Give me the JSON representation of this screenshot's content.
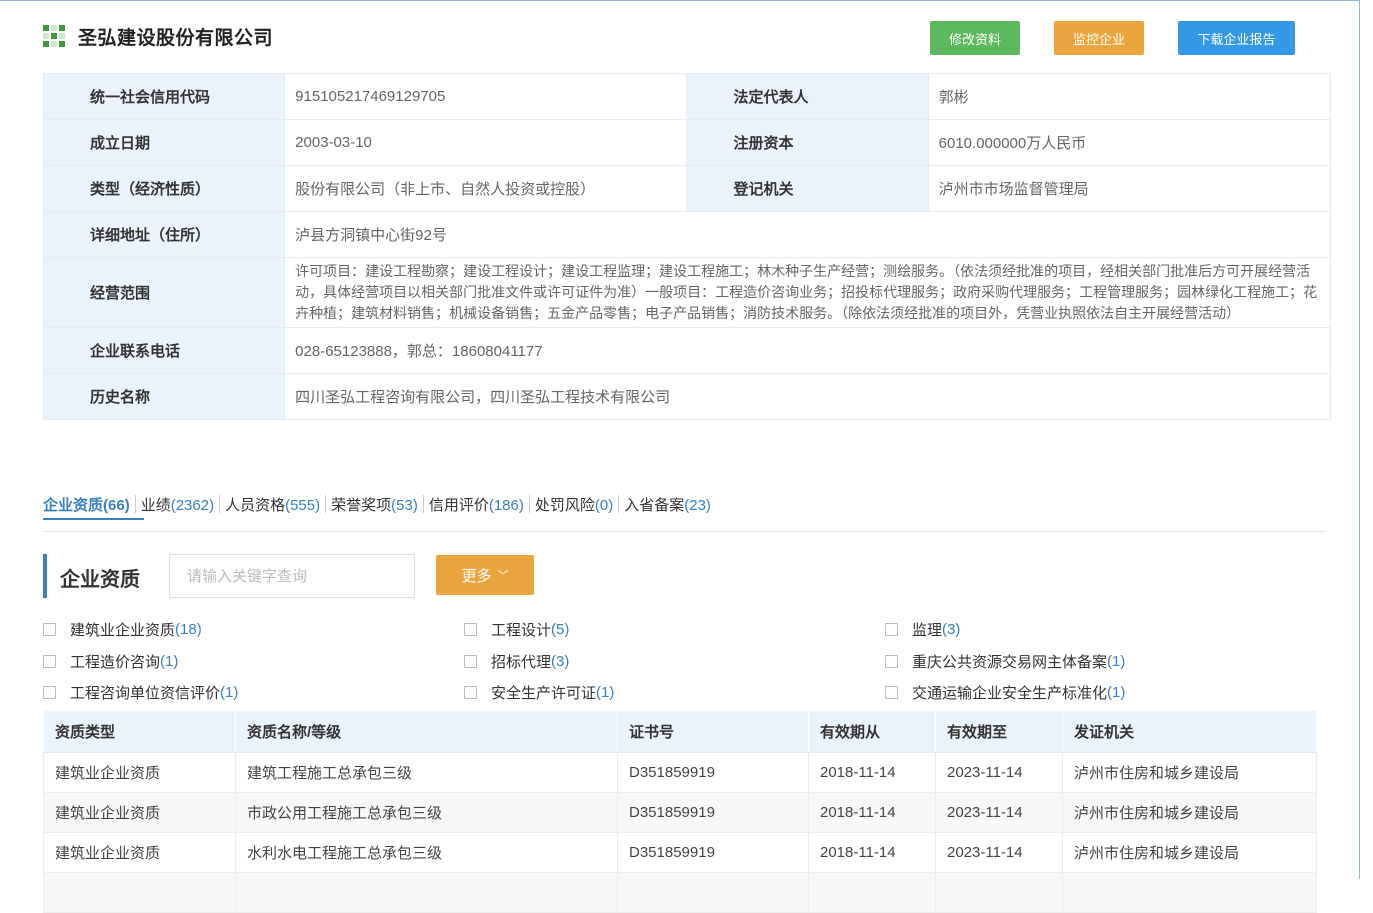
{
  "company": {
    "name": "圣弘建设股份有限公司"
  },
  "actions": {
    "edit": "修改资料",
    "monitor": "监控企业",
    "download": "下载企业报告"
  },
  "info": {
    "credit_code_label": "统一社会信用代码",
    "credit_code": "915105217469129705",
    "legal_rep_label": "法定代表人",
    "legal_rep": "郭彬",
    "found_date_label": "成立日期",
    "found_date": "2003-03-10",
    "capital_label": "注册资本",
    "capital": "6010.000000万人民币",
    "type_label": "类型（经济性质）",
    "type": "股份有限公司（非上市、自然人投资或控股）",
    "authority_label": "登记机关",
    "authority": "泸州市市场监督管理局",
    "address_label": "详细地址（住所）",
    "address": "泸县方洞镇中心街92号",
    "scope_label": "经营范围",
    "scope": "许可项目：建设工程勘察；建设工程设计；建设工程监理；建设工程施工；林木种子生产经营；测绘服务。（依法须经批准的项目，经相关部门批准后方可开展经营活动，具体经营项目以相关部门批准文件或许可证件为准）一般项目：工程造价咨询业务；招投标代理服务；政府采购代理服务；工程管理服务；园林绿化工程施工；花卉种植；建筑材料销售；机械设备销售；五金产品零售；电子产品销售；消防技术服务。（除依法须经批准的项目外，凭营业执照依法自主开展经营活动）",
    "phone_label": "企业联系电话",
    "phone": "028-65123888，郭总：18608041177",
    "former_names_label": "历史名称",
    "former_names": "四川圣弘工程咨询有限公司，四川圣弘工程技术有限公司"
  },
  "tabs": [
    {
      "label": "企业资质",
      "count": "(66)"
    },
    {
      "label": "业绩",
      "count": "(2362)"
    },
    {
      "label": "人员资格",
      "count": "(555)"
    },
    {
      "label": "荣誉奖项",
      "count": "(53)"
    },
    {
      "label": "信用评价",
      "count": "(186)"
    },
    {
      "label": "处罚风险",
      "count": "(0)"
    },
    {
      "label": "入省备案",
      "count": "(23)"
    }
  ],
  "section": {
    "title": "企业资质",
    "search_placeholder": "请输入关键字查询",
    "more_label": "更多",
    "more_icon": "chevron-down-icon"
  },
  "filters": [
    {
      "label": "建筑业企业资质",
      "count": "(18)"
    },
    {
      "label": "工程设计",
      "count": "(5)"
    },
    {
      "label": "监理",
      "count": "(3)"
    },
    {
      "label": "工程造价咨询",
      "count": "(1)"
    },
    {
      "label": "招标代理",
      "count": "(3)"
    },
    {
      "label": "重庆公共资源交易网主体备案",
      "count": "(1)"
    },
    {
      "label": "工程咨询单位资信评价",
      "count": "(1)"
    },
    {
      "label": "安全生产许可证",
      "count": "(1)"
    },
    {
      "label": "交通运输企业安全生产标准化",
      "count": "(1)"
    }
  ],
  "table": {
    "headers": [
      "资质类型",
      "资质名称/等级",
      "证书号",
      "有效期从",
      "有效期至",
      "发证机关"
    ],
    "rows": [
      [
        "建筑业企业资质",
        "建筑工程施工总承包三级",
        "D351859919",
        "2018-11-14",
        "2023-11-14",
        "泸州市住房和城乡建设局"
      ],
      [
        "建筑业企业资质",
        "市政公用工程施工总承包三级",
        "D351859919",
        "2018-11-14",
        "2023-11-14",
        "泸州市住房和城乡建设局"
      ],
      [
        "建筑业企业资质",
        "水利水电工程施工总承包三级",
        "D351859919",
        "2018-11-14",
        "2023-11-14",
        "泸州市住房和城乡建设局"
      ],
      [
        "",
        "",
        "",
        "",
        "",
        ""
      ]
    ]
  },
  "colors": {
    "accent": "#3a7fc2",
    "green": "#5cb85c",
    "orange": "#eba53e",
    "blue": "#3399e6",
    "label_bg": "#eaf3fc"
  }
}
